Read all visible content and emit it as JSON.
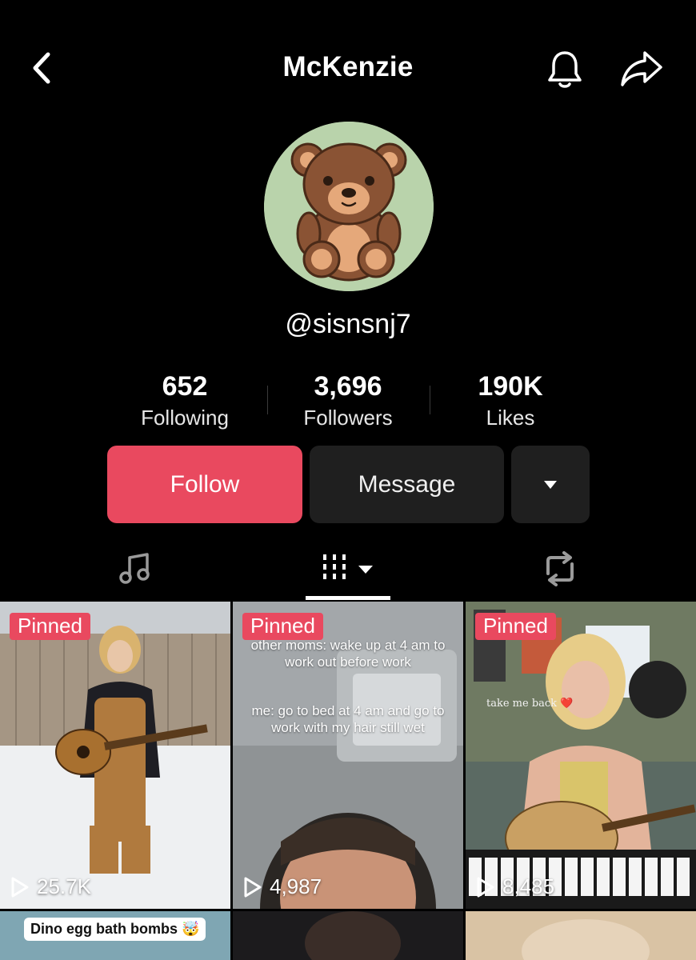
{
  "header": {
    "title": "McKenzie",
    "back_icon": "chevron-left-icon",
    "bell_icon": "bell-icon",
    "share_icon": "share-arrow-icon"
  },
  "profile": {
    "avatar": "teddy-bear-avatar",
    "handle": "@sisnsnj7"
  },
  "stats": [
    {
      "value": "652",
      "label": "Following"
    },
    {
      "value": "3,696",
      "label": "Followers"
    },
    {
      "value": "190K",
      "label": "Likes"
    }
  ],
  "actions": {
    "follow_label": "Follow",
    "message_label": "Message",
    "more_icon": "triangle-down-icon"
  },
  "tabs": {
    "music_icon": "music-note-icon",
    "videos_icon": "grid-bars-icon",
    "repost_icon": "repost-icon"
  },
  "videos": [
    {
      "pinned_label": "Pinned",
      "views": "25.7K"
    },
    {
      "pinned_label": "Pinned",
      "views": "4,987",
      "overlay_line1": "other moms: wake up at 4 am to work out before work",
      "overlay_line2": "me: go to bed at 4 am and go to work with my hair still wet"
    },
    {
      "pinned_label": "Pinned",
      "views": "8,485",
      "overlay_caption": "take me back ❤️"
    },
    {
      "caption": "Dino egg bath bombs 🤯"
    },
    {},
    {}
  ],
  "colors": {
    "accent": "#e9495f",
    "background": "#000000",
    "button_dark": "#1f1f1f"
  }
}
